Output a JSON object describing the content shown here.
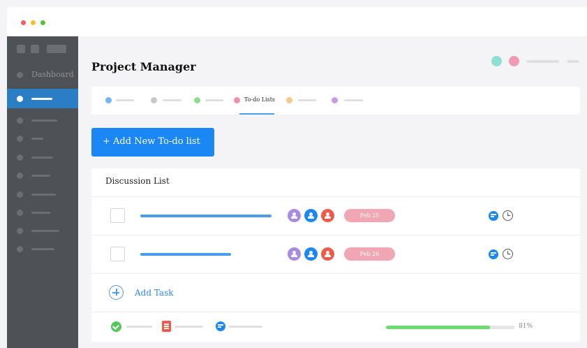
{
  "app": {
    "title": "Project Manager"
  },
  "sidebar": {
    "items": [
      {
        "label": "Dashboard"
      }
    ]
  },
  "tabs": {
    "active_label": "To-do Lists"
  },
  "toolbar": {
    "add_list_label": "+ Add New To-do list"
  },
  "discussion": {
    "title": "Discussion List",
    "tasks": [
      {
        "date": "Feb 25",
        "avatar_colors": [
          "#a98be6",
          "#1a87f5",
          "#ee5a4a"
        ]
      },
      {
        "date": "Feb 26",
        "avatar_colors": [
          "#a98be6",
          "#1a87f5",
          "#ee5a4a"
        ]
      }
    ],
    "add_task_label": "Add Task"
  },
  "footer": {
    "progress_label": "81%",
    "progress_value": 0.81
  },
  "colors": {
    "accent": "#1a87f5",
    "sidebar": "#4e5257",
    "date_pill": "#f1a7b3",
    "progress": "#6bdc6e"
  },
  "icons": [
    "check-circle-icon",
    "task-list-icon",
    "chat-icon",
    "clock-icon",
    "plus-icon",
    "user-icon"
  ]
}
